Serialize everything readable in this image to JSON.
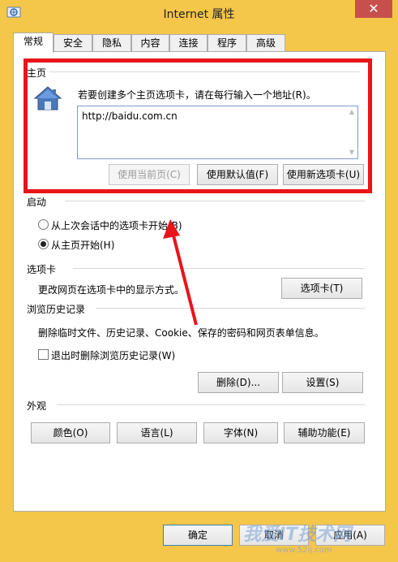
{
  "window": {
    "title": "Internet 属性",
    "close_glyph": "✕"
  },
  "tabs": [
    {
      "label": "常规",
      "active": true
    },
    {
      "label": "安全",
      "active": false
    },
    {
      "label": "隐私",
      "active": false
    },
    {
      "label": "内容",
      "active": false
    },
    {
      "label": "连接",
      "active": false
    },
    {
      "label": "程序",
      "active": false
    },
    {
      "label": "高级",
      "active": false
    }
  ],
  "homepage": {
    "section_label": "主页",
    "description": "若要创建多个主页选项卡，请在每行输入一个地址(R)。",
    "url_value": "http://baidu.com.cn",
    "use_current_label": "使用当前页(C)",
    "use_default_label": "使用默认值(F)",
    "use_new_tab_label": "使用新选项卡(U)"
  },
  "startup": {
    "section_label": "启动",
    "option_last_session": "从上次会话中的选项卡开始(B)",
    "option_homepage": "从主页开始(H)",
    "selected": "homepage"
  },
  "tabs_section": {
    "section_label": "选项卡",
    "description": "更改网页在选项卡中的显示方式。",
    "button_label": "选项卡(T)"
  },
  "history": {
    "section_label": "浏览历史记录",
    "description": "删除临时文件、历史记录、Cookie、保存的密码和网页表单信息。",
    "delete_on_exit_label": "退出时删除浏览历史记录(W)",
    "delete_on_exit_checked": false,
    "delete_button_label": "删除(D)...",
    "settings_button_label": "设置(S)"
  },
  "appearance": {
    "section_label": "外观",
    "colors_label": "颜色(O)",
    "languages_label": "语言(L)",
    "fonts_label": "字体(N)",
    "accessibility_label": "辅助功能(E)"
  },
  "footer": {
    "ok_label": "确定",
    "cancel_label": "取消",
    "apply_label": "应用(A)"
  },
  "watermark": {
    "text": "我爱IT技术网",
    "url": "www.52ij.com"
  },
  "colors": {
    "highlight": "#e8141a",
    "window_frame": "#f4c64a",
    "close_button": "#c7504d"
  }
}
